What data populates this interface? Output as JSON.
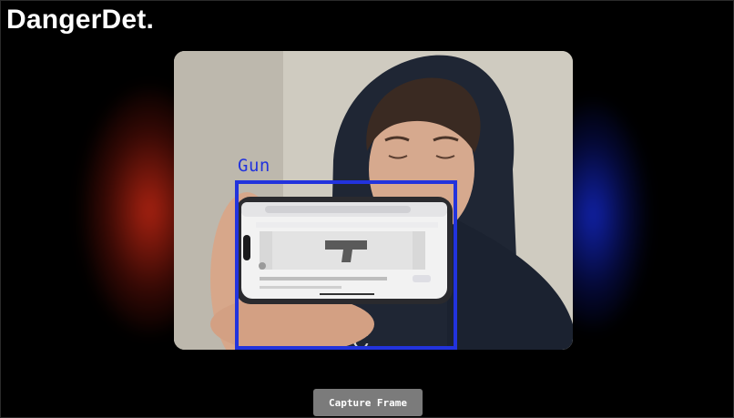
{
  "app": {
    "title": "DangerDet."
  },
  "video": {
    "detections": [
      {
        "label": "Gun",
        "color": "#2233dd"
      }
    ]
  },
  "actions": {
    "capture_label": "Capture Frame"
  },
  "colors": {
    "background": "#000000",
    "glow_left": "#c82814",
    "glow_right": "#1428c8",
    "button_bg": "#7b7b7b",
    "detection_box": "#2233dd"
  }
}
